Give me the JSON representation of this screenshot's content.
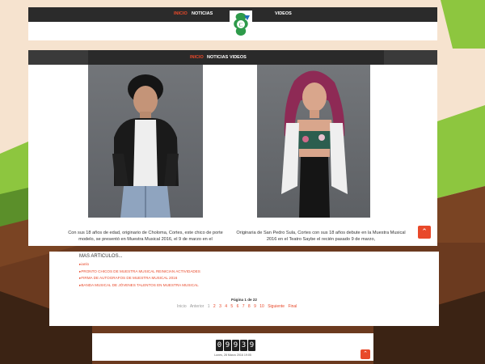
{
  "header": {
    "nav": [
      "INICIO",
      "NOTICIAS",
      "VIDEOS"
    ],
    "active": "INICIO"
  },
  "slider": {
    "nav": [
      "INICIO",
      "NOTICIAS",
      "VIDEOS"
    ],
    "slides": [
      {
        "caption": "Con sus 18 años de edad, originario de Choloma, Cortes, este chico de porte modelo, se presentó en Muestra Musical 2016, el 9 de marzo en el"
      },
      {
        "caption": "Originaria de San Pedro Sula, Cortes con sus 18 años debute en la Muestra Musical 2016 en el Teatro Saybe el recién pasado 9 de marzo,"
      }
    ],
    "scroll_up_icon": "chevron-up-icon"
  },
  "articles": {
    "title": "MAS ARTICULOS...",
    "items": [
      "ianlo",
      "PRONTO CHICOS DE MUESTRA MUSICAL REINICIAN ACTIVIDADES",
      "FIRMA DE AUTOGRAFOS DE MUESTRA MUSICAL 2016",
      "BANDA MUSICAL DE JÓVENES TALENTOS EN MUESTRA MUSICAL"
    ],
    "page_label": "Página 1 de 22",
    "pagination": {
      "first": "Inicio",
      "prev": "Anterior",
      "pages": [
        "1",
        "2",
        "3",
        "4",
        "5",
        "6",
        "7",
        "8",
        "9",
        "10"
      ],
      "next": "Siguiente",
      "last": "Final"
    }
  },
  "counter": {
    "digits": [
      "0",
      "9",
      "9",
      "3",
      "9"
    ],
    "date": "Lunes, 28 Marzo 2016 19:05"
  },
  "colors": {
    "accent": "#e8492a",
    "green": "#8dc63f",
    "brown": "#6b3a1f"
  }
}
